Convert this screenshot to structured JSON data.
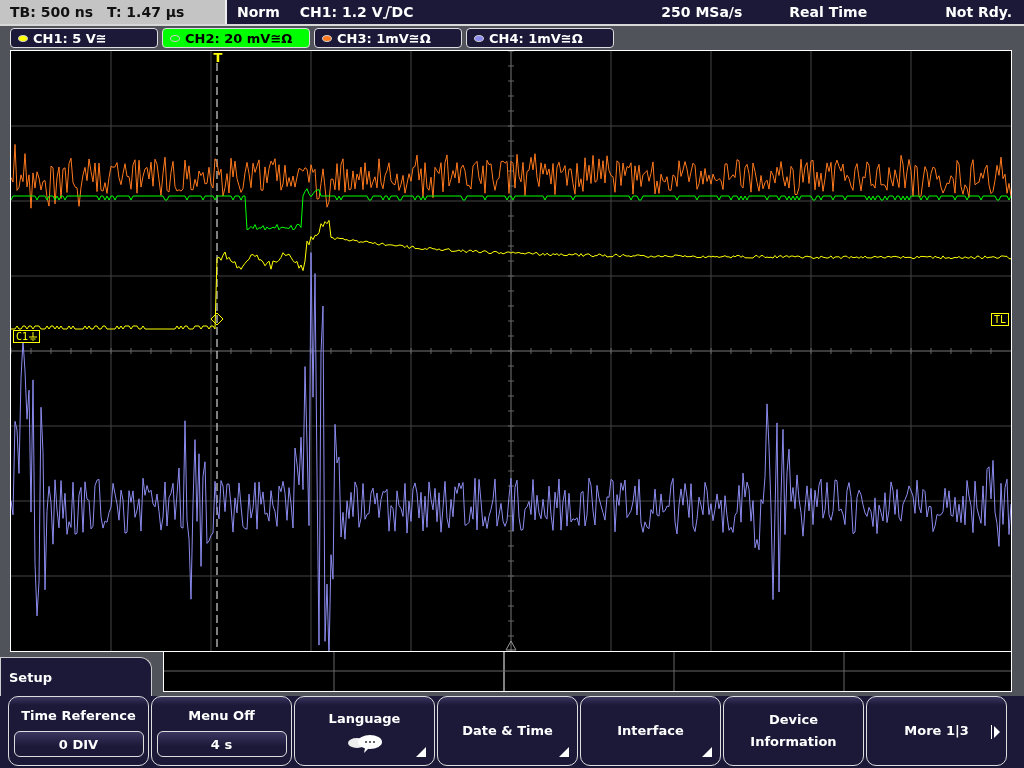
{
  "timebase": {
    "tb": "TB: 500 ns",
    "t": "T: 1.47 µs"
  },
  "status": {
    "mode": "Norm",
    "trigger": "CH1: 1.2 V",
    "coupling": "DC",
    "sample_rate": "250 MSa/s",
    "acquisition": "Real Time",
    "state": "Not Rdy."
  },
  "channels": [
    {
      "label": "CH1: 5 V≅",
      "color": "#ffff00",
      "selected": false
    },
    {
      "label": "CH2: 20 mV≅Ω",
      "color": "#00ff00",
      "selected": true
    },
    {
      "label": "CH3: 1mV≅Ω",
      "color": "#ff7a1e",
      "selected": false
    },
    {
      "label": "CH4: 1mV≅Ω",
      "color": "#8c8cf0",
      "selected": false
    }
  ],
  "trigger_marker": "T",
  "markers": [
    {
      "kind": "channel",
      "label": "C1"
    },
    {
      "kind": "level",
      "label": "TL"
    }
  ],
  "menu": {
    "title": "Setup"
  },
  "softkeys": [
    {
      "kind": "value",
      "label": "Time Reference",
      "value": "0 DIV"
    },
    {
      "kind": "value",
      "label": "Menu Off",
      "value": "4 s"
    },
    {
      "kind": "icon",
      "label": "Language"
    },
    {
      "kind": "submenu",
      "label": "Date & Time"
    },
    {
      "kind": "submenu",
      "label": "Interface"
    },
    {
      "kind": "plain",
      "label": "Device Information"
    },
    {
      "kind": "next",
      "label": "More 1|3"
    }
  ]
}
